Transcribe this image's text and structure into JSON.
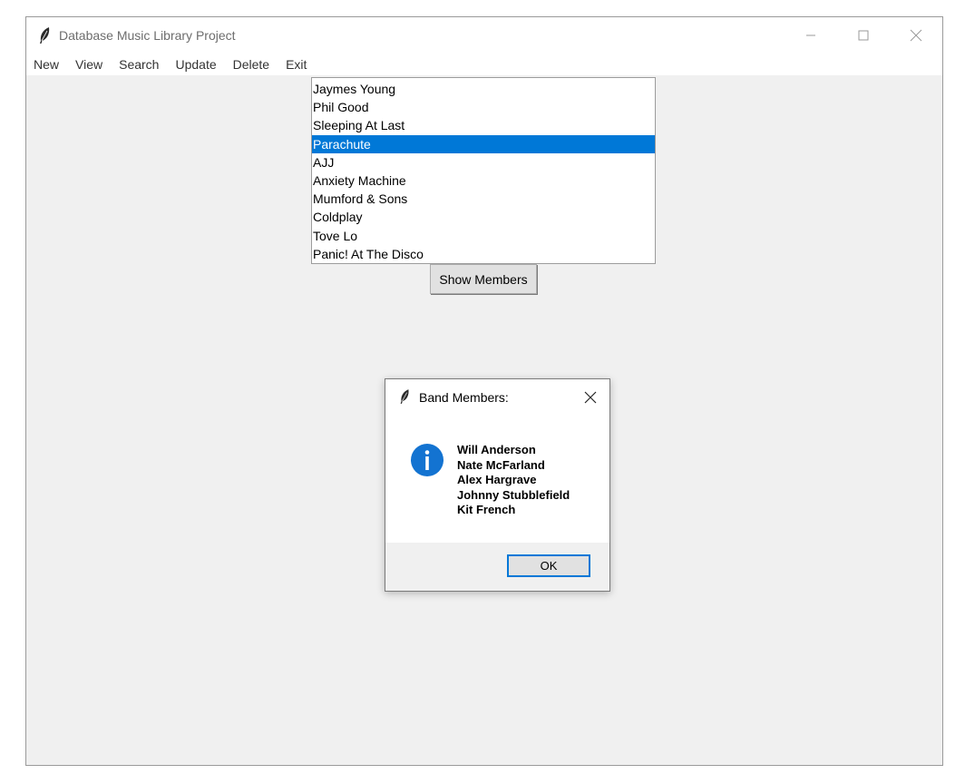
{
  "window": {
    "title": "Database Music Library Project",
    "icon": "feather-icon"
  },
  "menu": {
    "items": [
      "New",
      "View",
      "Search",
      "Update",
      "Delete",
      "Exit"
    ]
  },
  "bands": {
    "items": [
      "Jaymes Young",
      "Phil Good",
      "Sleeping At Last",
      "Parachute",
      "AJJ",
      "Anxiety Machine",
      "Mumford & Sons",
      "Coldplay",
      "Tove Lo",
      "Panic! At The Disco"
    ],
    "selected": "Parachute",
    "selected_color": "#0078d7"
  },
  "show_members_button": "Show Members",
  "dialog": {
    "title": "Band Members:",
    "icon": "info-icon",
    "members": [
      "Will Anderson",
      "Nate McFarland",
      "Alex Hargrave",
      "Johnny Stubblefield",
      "Kit French"
    ],
    "ok_label": "OK"
  }
}
